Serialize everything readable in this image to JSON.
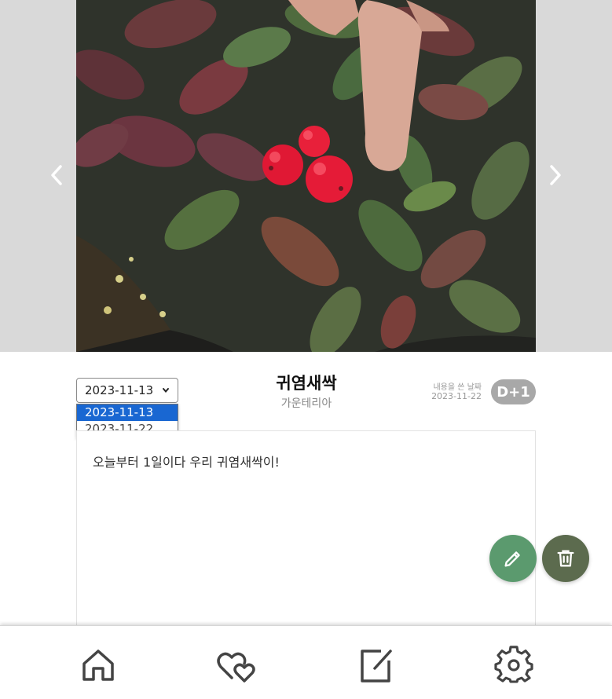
{
  "carousel": {
    "image_subject": "red-berry-groundcover-plant-photo",
    "prev_icon": "chevron-left-icon",
    "next_icon": "chevron-right-icon"
  },
  "date_select": {
    "selected": "2023-11-13",
    "options": [
      "2023-11-13",
      "2023-11-22"
    ]
  },
  "plant": {
    "nickname": "귀염새싹",
    "species": "가운테리아"
  },
  "written": {
    "label": "내용을 쓴 날짜",
    "date": "2023-11-22"
  },
  "dday": "D+1",
  "diary": {
    "content": "오늘부터 1일이다 우리 귀염새싹이!"
  },
  "actions": {
    "edit_icon": "pencil-icon",
    "delete_icon": "trash-icon"
  },
  "bottom_nav": {
    "items": [
      "home-icon",
      "hearts-icon",
      "write-icon",
      "settings-icon"
    ]
  },
  "colors": {
    "edit_fab": "#5b9a6e",
    "delete_fab": "#5c6b4e",
    "dday_badge": "#a8a8a8",
    "dropdown_selected": "#1967d2"
  }
}
